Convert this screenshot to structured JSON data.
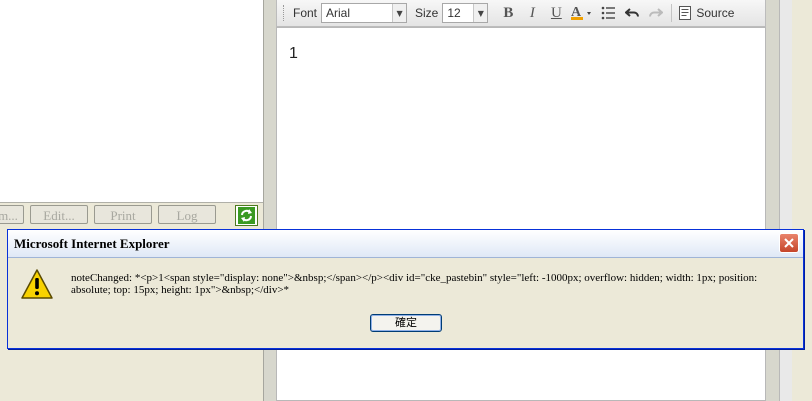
{
  "left_buttons": [
    "m...",
    "Edit...",
    "Print",
    "Log"
  ],
  "toolbar": {
    "font_label": "Font",
    "font_value": "Arial",
    "size_label": "Size",
    "size_value": "12",
    "bold": "B",
    "italic": "I",
    "underline": "U",
    "source_label": "Source"
  },
  "editor": {
    "content": "1"
  },
  "dialog": {
    "title": "Microsoft Internet Explorer",
    "message": "noteChanged:   *<p>1<span style=\"display: none\">&nbsp;</span></p><div id=\"cke_pastebin\" style=\"left: -1000px; overflow: hidden; width: 1px; position: absolute; top: 15px; height: 1px\">&nbsp;</div>*",
    "ok_label": "確定"
  }
}
